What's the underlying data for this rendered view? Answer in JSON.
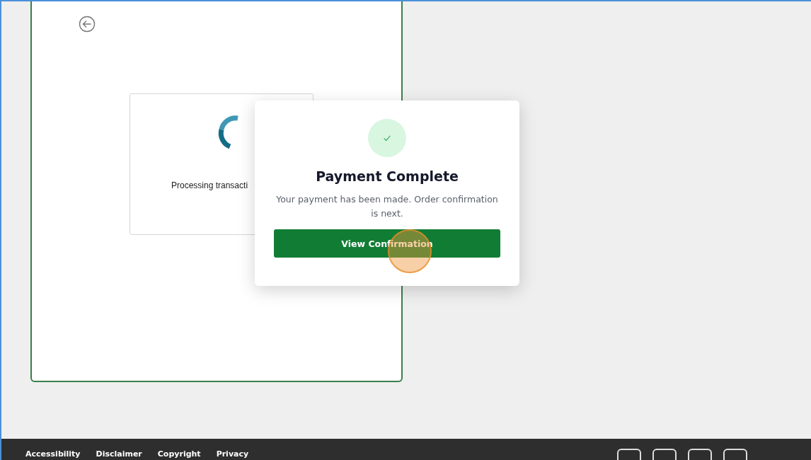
{
  "processing_card": {
    "message": "Processing transacti"
  },
  "dialog": {
    "title": "Payment Complete",
    "message": "Your payment has been made. Order confirmation is next.",
    "button": "View Confirmation"
  },
  "footer": {
    "links": [
      "Accessibility",
      "Disclaimer",
      "Copyright",
      "Privacy"
    ]
  }
}
